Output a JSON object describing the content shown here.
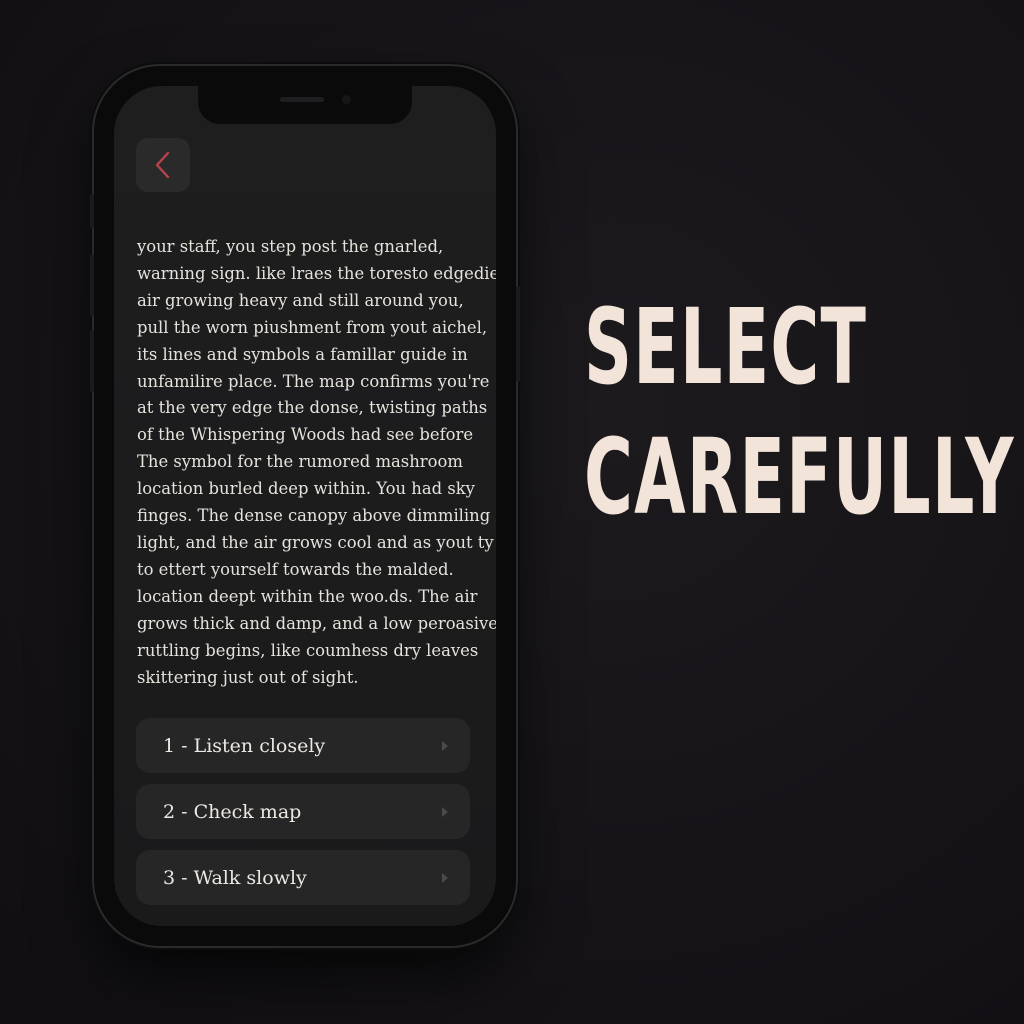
{
  "colors": {
    "background": "#151316",
    "screen": "#1e1e1f",
    "card": "#262627",
    "text": "#e6e2dc",
    "back_chevron": "#b8434a",
    "headline": "#f3e4da"
  },
  "header": {
    "back_icon": "chevron-left-icon"
  },
  "story": {
    "lines": [
      "your staff, you step post the gnarled,",
      "warning sign. like lraes the toresto edgedie",
      "air growing heavy and still around you,",
      "pull the worn piushment from yout aichel,",
      "its lines and symbols a famillar guide in",
      "unfamilire place. The map confirms you're",
      "at the very edge the donse, twisting paths",
      "of the Whispering Woods had see before",
      "The symbol for the rumored mashroom",
      "location burled deep within. You had sky",
      "finges. The dense canopy above dimmiling",
      "light, and the air grows cool and as yout ty",
      "to ettert yourself towards the malded.",
      "location deept within the woo.ds. The air",
      "grows thick and damp, and a low peroasive",
      "ruttling begins, like coumhess dry leaves",
      "skittering just out of sight."
    ]
  },
  "choices": [
    {
      "label": "1 - Listen closely",
      "icon": "play-arrow-icon"
    },
    {
      "label": "2 - Check map",
      "icon": "play-arrow-icon"
    },
    {
      "label": "3 - Walk slowly",
      "icon": "play-arrow-icon"
    }
  ],
  "headline": {
    "line1": "SELECT",
    "line2": "CAREFULLY"
  }
}
